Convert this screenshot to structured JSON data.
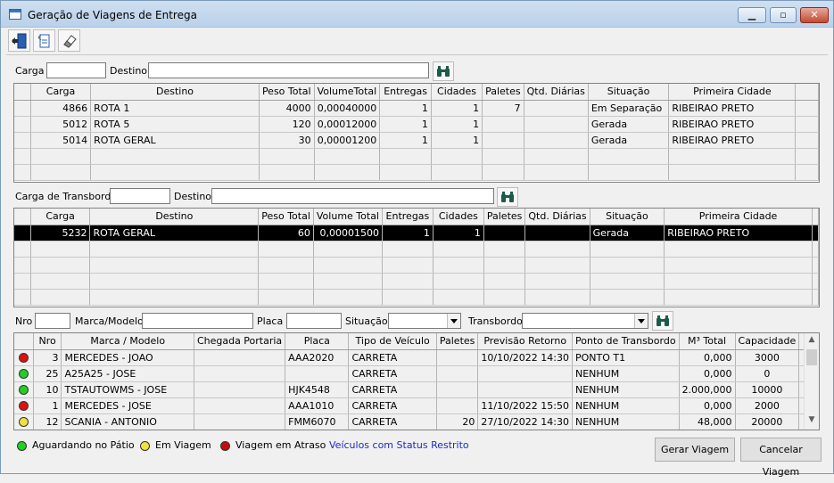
{
  "window": {
    "title": "Geração de Viagens de Entrega",
    "min": "▁",
    "max": "▫",
    "close": "✕"
  },
  "toolbar": {
    "exit_icon": "exit-door-icon",
    "refresh_icon": "page-exchange-icon",
    "clear_icon": "eraser-icon"
  },
  "filter1": {
    "carga_label": "Carga",
    "carga_value": "",
    "destino_label": "Destino",
    "destino_value": "",
    "search_icon": "binoculars-icon"
  },
  "grid1": {
    "columns": [
      "Carga",
      "Destino",
      "Peso Total",
      "VolumeTotal",
      "Entregas",
      "Cidades",
      "Paletes",
      "Qtd. Diárias",
      "Situação",
      "Primeira Cidade"
    ],
    "rows": [
      [
        "4866",
        "ROTA 1",
        "4000",
        "0,00040000",
        "1",
        "1",
        "7",
        "",
        "Em Separação",
        "RIBEIRAO PRETO"
      ],
      [
        "5012",
        "ROTA 5",
        "120",
        "0,00012000",
        "1",
        "1",
        "",
        "",
        "Gerada",
        "RIBEIRAO PRETO"
      ],
      [
        "5014",
        "ROTA GERAL",
        "30",
        "0,00001200",
        "1",
        "1",
        "",
        "",
        "Gerada",
        "RIBEIRAO PRETO"
      ]
    ]
  },
  "filter2": {
    "carga_label": "Carga de Transbordo",
    "carga_value": "",
    "destino_label": "Destino",
    "destino_value": "",
    "search_icon": "binoculars-icon"
  },
  "grid2": {
    "columns": [
      "Carga",
      "Destino",
      "Peso Total",
      "Volume Total",
      "Entregas",
      "Cidades",
      "Paletes",
      "Qtd. Diárias",
      "Situação",
      "Primeira Cidade"
    ],
    "rows": [
      [
        "5232",
        "ROTA GERAL",
        "60",
        "0,00001500",
        "1",
        "1",
        "",
        "",
        "Gerada",
        "RIBEIRAO PRETO"
      ]
    ]
  },
  "filter3": {
    "nro_label": "Nro",
    "nro_value": "",
    "marca_label": "Marca/Modelo",
    "marca_value": "",
    "placa_label": "Placa",
    "placa_value": "",
    "situacao_label": "Situação",
    "situacao_value": "",
    "transbordo_label": "Transbordo",
    "transbordo_value": "",
    "search_icon": "binoculars-icon"
  },
  "grid3": {
    "columns": [
      "",
      "Nro",
      "Marca / Modelo",
      "Chegada Portaria",
      "Placa",
      "Tipo de Veículo",
      "Paletes",
      "Previsão Retorno",
      "Ponto de Transbordo",
      "M³ Total",
      "Capacidade"
    ],
    "rows": [
      {
        "status": "#e01010",
        "cells": [
          "3",
          "MERCEDES - JOAO",
          "",
          "AAA2020",
          "CARRETA",
          "",
          "10/10/2022 14:30",
          "PONTO T1",
          "0,000",
          "3000"
        ]
      },
      {
        "status": "#22d022",
        "cells": [
          "25",
          "A25A25 - JOSE",
          "",
          "",
          "CARRETA",
          "",
          "",
          "NENHUM",
          "0,000",
          "0"
        ]
      },
      {
        "status": "#22d022",
        "cells": [
          "10",
          "TSTAUTOWMS - JOSE",
          "",
          "HJK4548",
          "CARRETA",
          "",
          "",
          "NENHUM",
          "2.000,000",
          "10000"
        ]
      },
      {
        "status": "#e01010",
        "cells": [
          "1",
          "MERCEDES - JOSE",
          "",
          "AAA1010",
          "CARRETA",
          "",
          "11/10/2022 15:50",
          "NENHUM",
          "0,000",
          "2000"
        ]
      },
      {
        "status": "#f0e040",
        "cells": [
          "12",
          "SCANIA - ANTONIO",
          "",
          "FMM6070",
          "CARRETA",
          "20",
          "27/10/2022 14:30",
          "NENHUM",
          "48,000",
          "20000"
        ]
      }
    ]
  },
  "legend": {
    "patio": "Aguardando no Pátio",
    "patio_color": "#22d022",
    "viagem": "Em Viagem",
    "viagem_color": "#f0e040",
    "atraso": "Viagem em Atraso",
    "atraso_color": "#c01010",
    "restrito": "Veículos com Status Restrito"
  },
  "buttons": {
    "gerar": "Gerar Viagem",
    "cancelar": "Cancelar Viagem"
  }
}
